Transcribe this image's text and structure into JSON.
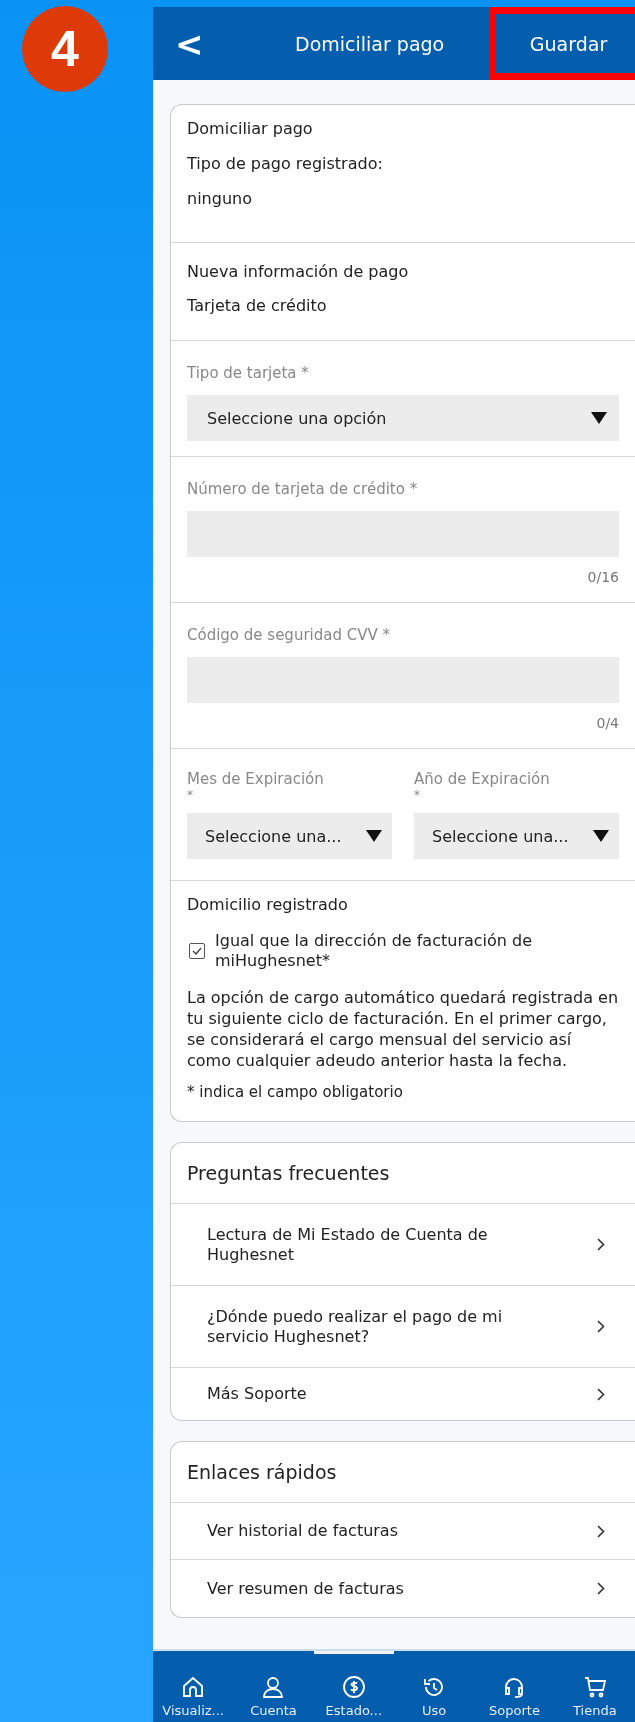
{
  "step_badge": "4",
  "header": {
    "back": "<",
    "title": "Domiciliar pago",
    "action": {
      "label": "Guardar",
      "highlighted": true
    }
  },
  "current": {
    "heading": "Domiciliar pago",
    "label": "Tipo de pago registrado:",
    "value": "ninguno"
  },
  "new_payment": {
    "heading": "Nueva información de pago",
    "method": "Tarjeta de crédito"
  },
  "card_type": {
    "label": "Tipo de tarjeta *",
    "value": "Seleccione una opción"
  },
  "fields": [
    {
      "label": "Número de tarjeta de crédito *",
      "counter": "0/16"
    },
    {
      "label": "Código de seguridad CVV *",
      "counter": "0/4"
    }
  ],
  "expiry": [
    {
      "label": "Mes de Expiración",
      "required": "*",
      "value": "Seleccione una..."
    },
    {
      "label": "Año de Expiración",
      "required": "*",
      "value": "Seleccione una..."
    }
  ],
  "address": {
    "heading": "Domicilio registrado",
    "checkbox": {
      "label": "Igual que la dirección de facturación de miHughesnet*",
      "checked": true
    },
    "note": "La opción de cargo automático quedará registrada en tu siguiente ciclo de facturación. En el primer cargo, se considerará el cargo mensual del servicio así como cualquier adeudo anterior hasta la fecha.",
    "footnote": "* indica el campo obligatorio"
  },
  "faq": {
    "title": "Preguntas frecuentes",
    "items": [
      "Lectura de Mi Estado de Cuenta de Hughesnet",
      "¿Dónde puedo realizar el pago de mi servicio Hughesnet?",
      "Más Soporte"
    ]
  },
  "quick_links": {
    "title": "Enlaces rápidos",
    "items": [
      "Ver historial de facturas",
      "Ver resumen de facturas"
    ]
  },
  "nav": [
    {
      "kind": "home",
      "label": "Visualiz...",
      "selected": false
    },
    {
      "kind": "user",
      "label": "Cuenta",
      "selected": false
    },
    {
      "kind": "dollar",
      "label": "Estado...",
      "selected": true
    },
    {
      "kind": "history",
      "label": "Uso",
      "selected": false
    },
    {
      "kind": "headset",
      "label": "Soporte",
      "selected": false
    },
    {
      "kind": "cart",
      "label": "Tienda",
      "selected": false
    }
  ]
}
